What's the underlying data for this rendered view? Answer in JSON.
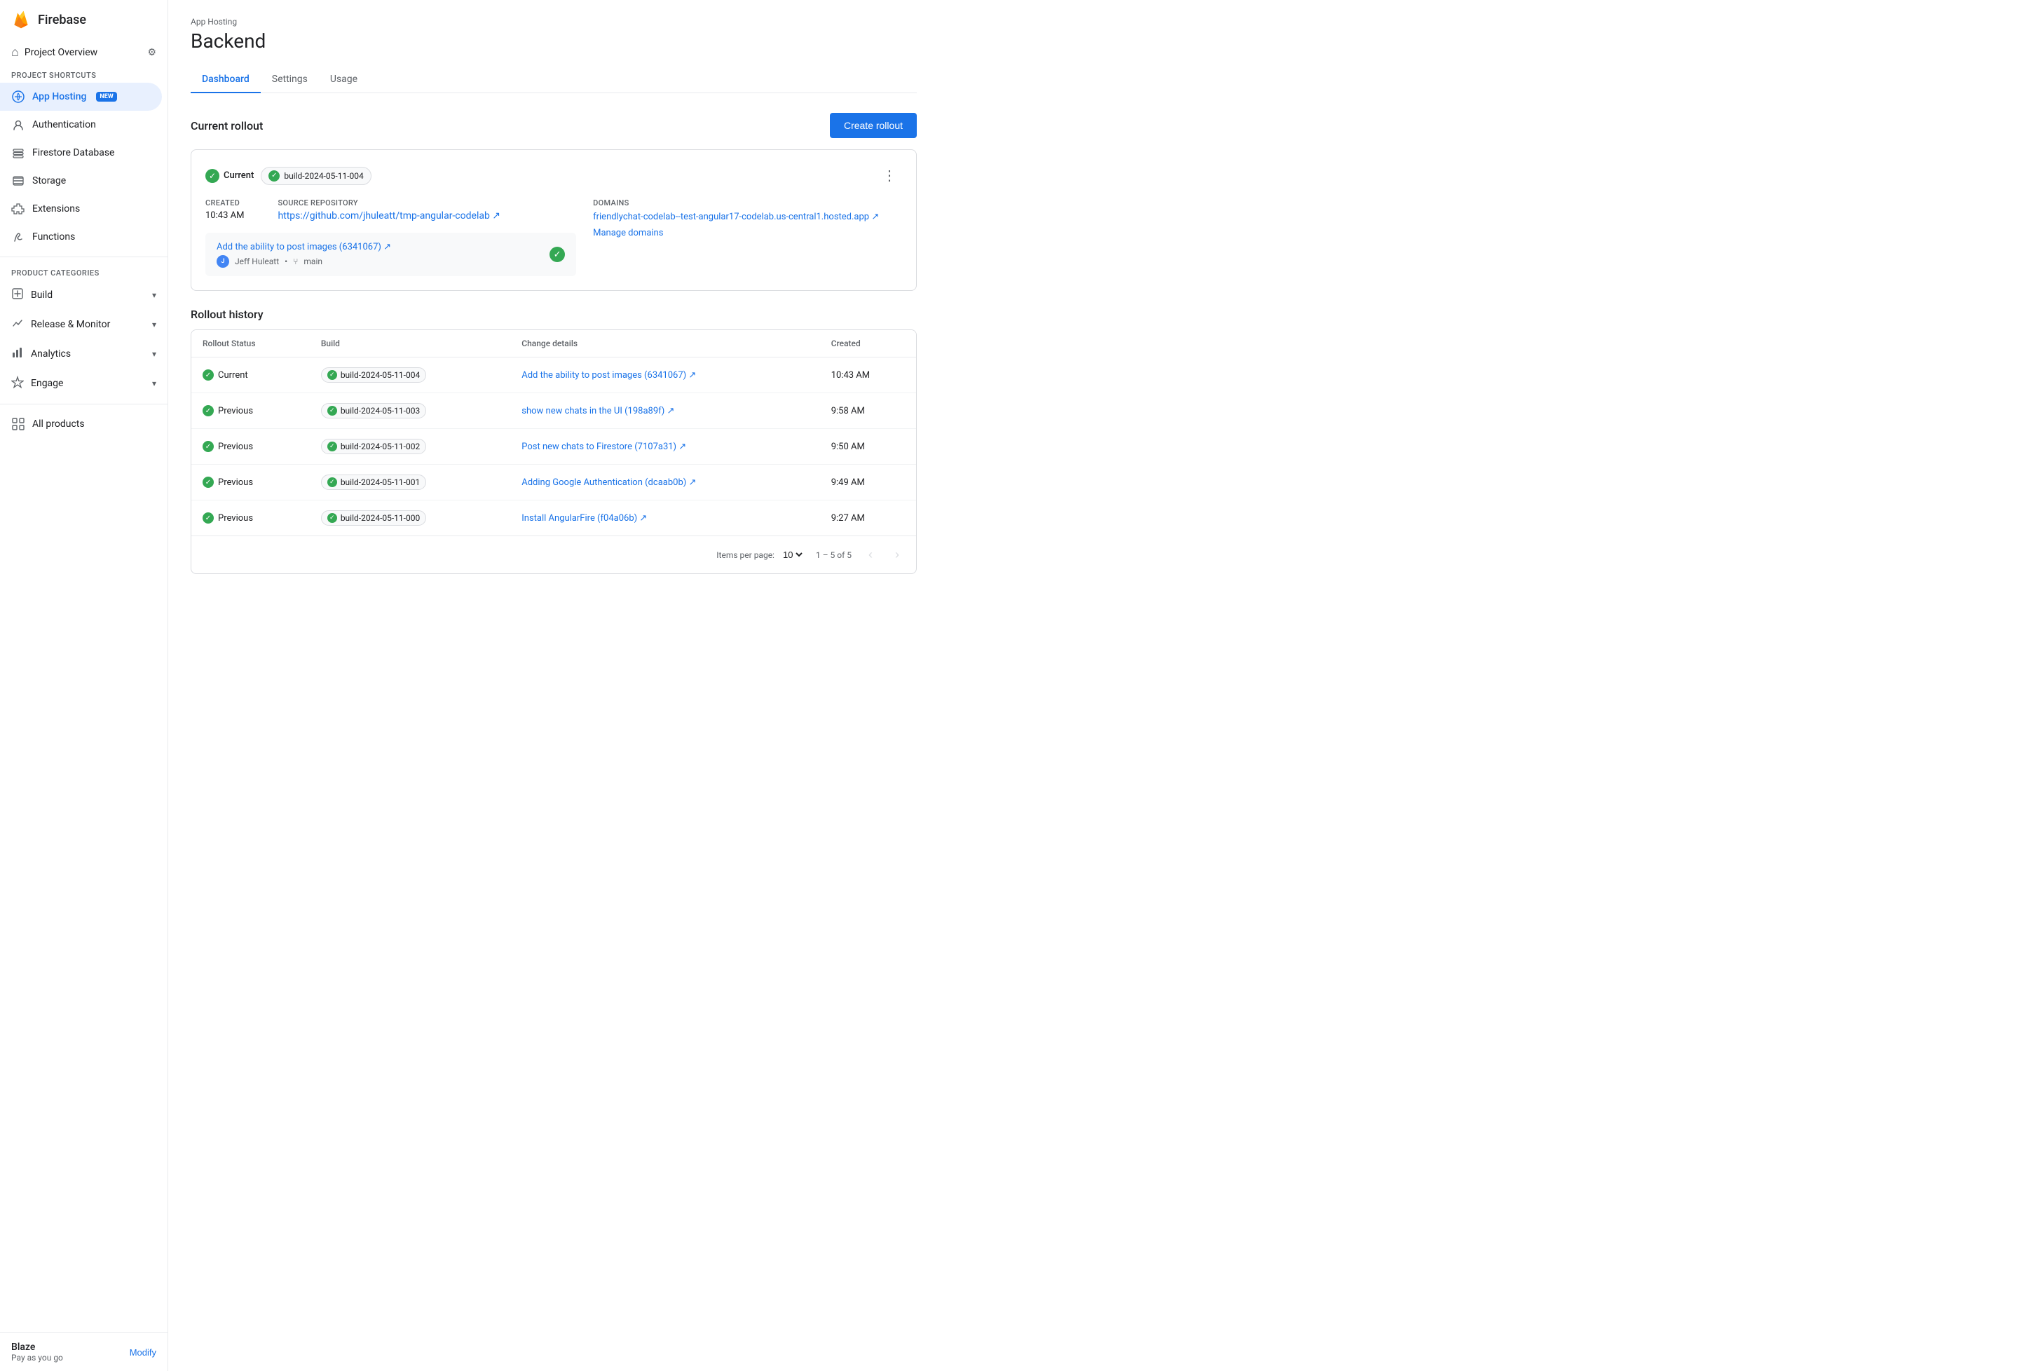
{
  "sidebar": {
    "app_name": "Firebase",
    "project_overview_label": "Project Overview",
    "project_shortcuts_label": "Project shortcuts",
    "nav_items": [
      {
        "id": "app-hosting",
        "label": "App Hosting",
        "badge": "NEW",
        "active": true
      },
      {
        "id": "authentication",
        "label": "Authentication",
        "active": false
      },
      {
        "id": "firestore",
        "label": "Firestore Database",
        "active": false
      },
      {
        "id": "storage",
        "label": "Storage",
        "active": false
      },
      {
        "id": "extensions",
        "label": "Extensions",
        "active": false
      },
      {
        "id": "functions",
        "label": "Functions",
        "active": false
      }
    ],
    "product_categories_label": "Product categories",
    "categories": [
      {
        "id": "build",
        "label": "Build"
      },
      {
        "id": "release-monitor",
        "label": "Release & Monitor"
      },
      {
        "id": "analytics",
        "label": "Analytics"
      },
      {
        "id": "engage",
        "label": "Engage"
      }
    ],
    "all_products_label": "All products",
    "footer": {
      "plan_name": "Blaze",
      "plan_sub": "Pay as you go",
      "modify_label": "Modify"
    }
  },
  "header": {
    "breadcrumb": "App Hosting",
    "title": "Backend",
    "tabs": [
      "Dashboard",
      "Settings",
      "Usage"
    ],
    "active_tab": "Dashboard"
  },
  "current_rollout": {
    "section_title": "Current rollout",
    "create_rollout_label": "Create rollout",
    "status_label": "Current",
    "build_id": "build-2024-05-11-004",
    "created_label": "Created",
    "created_value": "10:43 AM",
    "source_repo_label": "Source repository",
    "source_repo_url": "https://github.com/jhuleatt/tmp-angular-codelab",
    "source_repo_display": "https://github.com/jhuleatt/tmp-angular-codelab ↗",
    "domains_label": "Domains",
    "domain_url": "friendlychat-codelab--test-angular17-codelab.us-central1.hosted.app",
    "domain_display": "friendlychat-codelab--test-angular17-codelab.us-central1.hosted.app ↗",
    "commit_link": "Add the ability to post images (6341067) ↗",
    "commit_author": "Jeff Huleatt",
    "commit_branch": "main",
    "manage_domains_label": "Manage domains"
  },
  "rollout_history": {
    "section_title": "Rollout history",
    "columns": [
      "Rollout Status",
      "Build",
      "Change details",
      "Created"
    ],
    "rows": [
      {
        "status": "Current",
        "build": "build-2024-05-11-004",
        "change": "Add the ability to post images (6341067) ↗",
        "created": "10:43 AM"
      },
      {
        "status": "Previous",
        "build": "build-2024-05-11-003",
        "change": "show new chats in the UI (198a89f) ↗",
        "created": "9:58 AM"
      },
      {
        "status": "Previous",
        "build": "build-2024-05-11-002",
        "change": "Post new chats to Firestore (7107a31) ↗",
        "created": "9:50 AM"
      },
      {
        "status": "Previous",
        "build": "build-2024-05-11-001",
        "change": "Adding Google Authentication (dcaab0b) ↗",
        "created": "9:49 AM"
      },
      {
        "status": "Previous",
        "build": "build-2024-05-11-000",
        "change": "Install AngularFire (f04a06b) ↗",
        "created": "9:27 AM"
      }
    ],
    "items_per_page_label": "Items per page:",
    "items_per_page_value": "10",
    "pagination_label": "1 – 5 of 5"
  }
}
